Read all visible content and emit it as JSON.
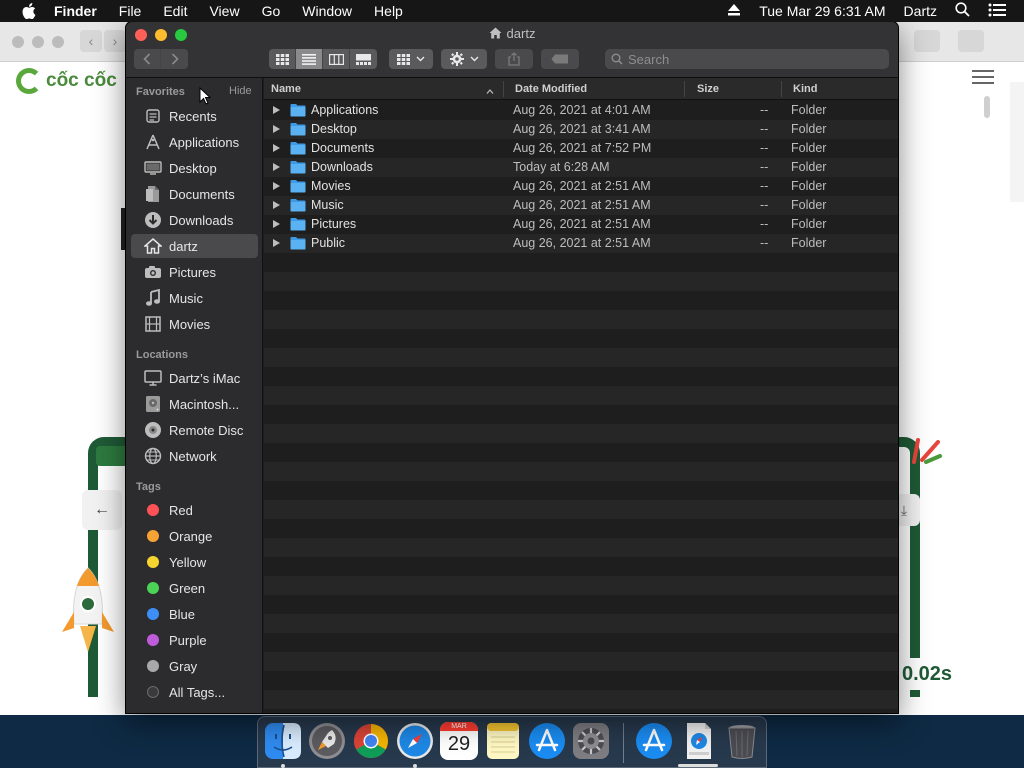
{
  "menubar": {
    "app_name": "Finder",
    "menus": [
      "File",
      "Edit",
      "View",
      "Go",
      "Window",
      "Help"
    ],
    "datetime": "Tue Mar 29  6:31 AM",
    "user": "Dartz"
  },
  "browser": {
    "logo_text": "cốc cốc",
    "speed_text": "0.02s"
  },
  "finder": {
    "title": "dartz",
    "search_placeholder": "Search",
    "sidebar": {
      "favorites_label": "Favorites",
      "hide_label": "Hide",
      "favorites": [
        {
          "label": "Recents",
          "icon": "recents-icon"
        },
        {
          "label": "Applications",
          "icon": "applications-icon"
        },
        {
          "label": "Desktop",
          "icon": "desktop-icon"
        },
        {
          "label": "Documents",
          "icon": "documents-icon"
        },
        {
          "label": "Downloads",
          "icon": "downloads-icon"
        },
        {
          "label": "dartz",
          "icon": "home-icon",
          "selected": true
        },
        {
          "label": "Pictures",
          "icon": "pictures-icon"
        },
        {
          "label": "Music",
          "icon": "music-icon"
        },
        {
          "label": "Movies",
          "icon": "movies-icon"
        }
      ],
      "locations_label": "Locations",
      "locations": [
        {
          "label": "Dartz’s iMac",
          "icon": "imac-icon"
        },
        {
          "label": "Macintosh...",
          "icon": "disk-icon"
        },
        {
          "label": "Remote Disc",
          "icon": "remote-disc-icon"
        },
        {
          "label": "Network",
          "icon": "network-icon"
        }
      ],
      "tags_label": "Tags",
      "tags": [
        {
          "label": "Red",
          "color": "#ff5257"
        },
        {
          "label": "Orange",
          "color": "#f7a234"
        },
        {
          "label": "Yellow",
          "color": "#f6d530"
        },
        {
          "label": "Green",
          "color": "#4cd256"
        },
        {
          "label": "Blue",
          "color": "#3d8ef6"
        },
        {
          "label": "Purple",
          "color": "#be5cdc"
        },
        {
          "label": "Gray",
          "color": "#a8a8a8"
        },
        {
          "label": "All Tags...",
          "color": "#555555"
        }
      ]
    },
    "columns": {
      "name": "Name",
      "date": "Date Modified",
      "size": "Size",
      "kind": "Kind"
    },
    "files": [
      {
        "name": "Applications",
        "date": "Aug 26, 2021 at 4:01 AM",
        "size": "--",
        "kind": "Folder"
      },
      {
        "name": "Desktop",
        "date": "Aug 26, 2021 at 3:41 AM",
        "size": "--",
        "kind": "Folder"
      },
      {
        "name": "Documents",
        "date": "Aug 26, 2021 at 7:52 PM",
        "size": "--",
        "kind": "Folder"
      },
      {
        "name": "Downloads",
        "date": "Today at 6:28 AM",
        "size": "--",
        "kind": "Folder"
      },
      {
        "name": "Movies",
        "date": "Aug 26, 2021 at 2:51 AM",
        "size": "--",
        "kind": "Folder"
      },
      {
        "name": "Music",
        "date": "Aug 26, 2021 at 2:51 AM",
        "size": "--",
        "kind": "Folder"
      },
      {
        "name": "Pictures",
        "date": "Aug 26, 2021 at 2:51 AM",
        "size": "--",
        "kind": "Folder"
      },
      {
        "name": "Public",
        "date": "Aug 26, 2021 at 2:51 AM",
        "size": "--",
        "kind": "Folder"
      }
    ]
  },
  "dock": {
    "calendar_month": "MAR",
    "calendar_day": "29",
    "items": [
      {
        "name": "finder-icon",
        "running": true
      },
      {
        "name": "launchpad-icon",
        "running": false
      },
      {
        "name": "chrome-icon",
        "running": false
      },
      {
        "name": "safari-icon",
        "running": true
      },
      {
        "name": "calendar-icon",
        "running": false
      },
      {
        "name": "notes-icon",
        "running": false
      },
      {
        "name": "app-store-icon",
        "running": false
      },
      {
        "name": "system-preferences-icon",
        "running": false
      },
      {
        "name": "app-store-download-icon",
        "running": false
      },
      {
        "name": "downloads-stack-icon",
        "running": false
      },
      {
        "name": "trash-icon",
        "running": false
      }
    ]
  }
}
